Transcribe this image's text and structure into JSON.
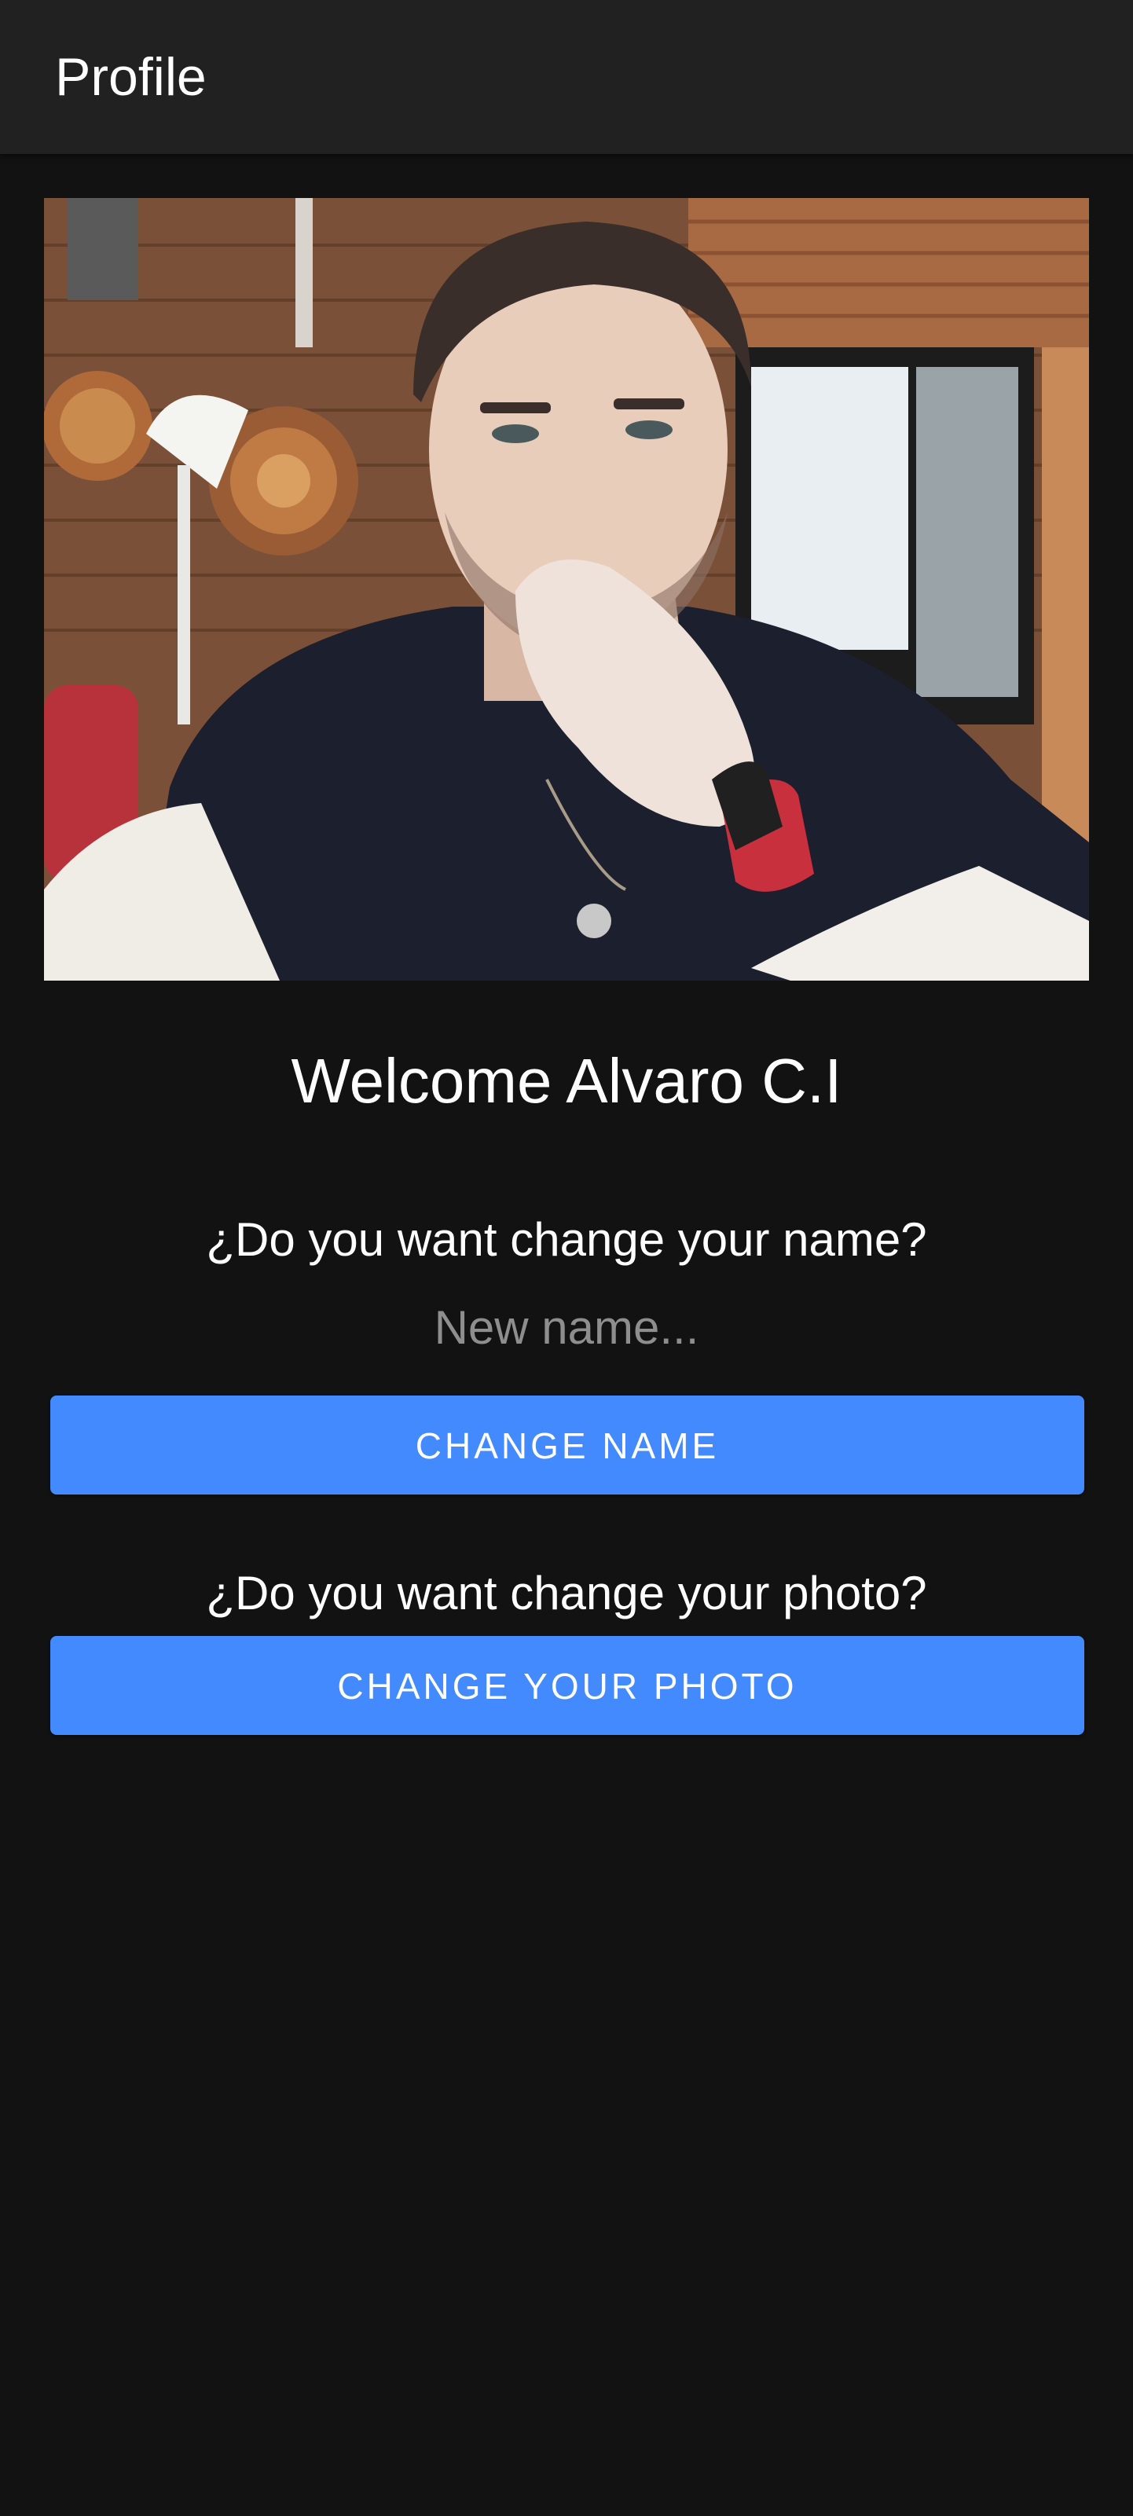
{
  "app_bar": {
    "title": "Profile"
  },
  "profile": {
    "photo_alt": "Profile photo",
    "welcome": "Welcome Alvaro C.I"
  },
  "name_section": {
    "question": "¿Do you want change your name?",
    "input_value": "",
    "input_placeholder": "New name...",
    "button_label": "CHANGE NAME"
  },
  "photo_section": {
    "question": "¿Do you want change your photo?",
    "button_label": "CHANGE YOUR PHOTO"
  },
  "colors": {
    "background": "#121212",
    "app_bar": "#212121",
    "accent": "#448aff",
    "placeholder": "#8e8e8e"
  }
}
